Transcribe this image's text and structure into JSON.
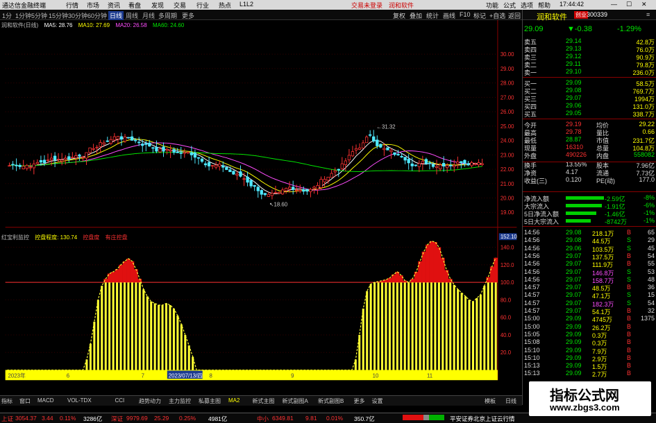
{
  "window": {
    "title": "通达信金融终端",
    "menus": [
      "行情",
      "市场",
      "资讯",
      "看盘",
      "发现",
      "交易",
      "行业",
      "热点",
      "L1L2"
    ],
    "center_links": [
      "交易未登录",
      "润和软件"
    ],
    "right_menus": [
      "功能",
      "公式",
      "选项",
      "帮助"
    ],
    "time": "17:44:42"
  },
  "toolbar": {
    "periods": [
      "1分",
      "1分钟",
      "5分钟",
      "15分钟",
      "30分钟",
      "60分钟",
      "日线",
      "周线",
      "月线",
      "多周期",
      "更多"
    ],
    "right_buttons": [
      "复权",
      "叠加",
      "统计",
      "画线",
      "F10",
      "标记",
      "+自选",
      "返回"
    ]
  },
  "chart": {
    "legend": [
      {
        "text": "润和软件(日线)",
        "color": "#bbbbbb"
      },
      {
        "text": "MA5: 28.76",
        "color": "#ffffff"
      },
      {
        "text": "MA10: 27.69",
        "color": "#ffff00"
      },
      {
        "text": "MA20: 26.58",
        "color": "#ff4dff"
      },
      {
        "text": "MA60: 24.60",
        "color": "#00e600"
      }
    ],
    "price_labels": [
      "30.00",
      "29.00",
      "28.00",
      "27.00",
      "26.00",
      "25.00",
      "24.00",
      "23.00",
      "22.00",
      "21.00",
      "20.00",
      "19.00"
    ],
    "high_mark": "31.32",
    "low_mark": "18.60"
  },
  "indicator": {
    "legend": [
      {
        "text": "红宝利监控",
        "color": "#bbbbbb"
      },
      {
        "text": "控盘程度: 130.74",
        "color": "#ffff00"
      },
      {
        "text": "控盘度",
        "color": "#ff3232"
      },
      {
        "text": "有庄控盘",
        "color": "#ff3232"
      }
    ],
    "axis_labels": [
      "152.10",
      "140.0",
      "120.0",
      "100.0",
      "80.0",
      "60.0",
      "40.0",
      "20.0"
    ],
    "series": [
      0,
      0,
      0,
      0,
      0,
      0,
      0,
      0,
      0,
      0,
      0,
      0,
      0,
      0,
      0,
      0,
      0,
      0,
      0,
      0,
      0,
      12,
      30,
      55,
      80,
      96,
      104,
      110,
      112,
      115,
      120,
      124,
      127,
      124,
      115,
      104,
      92,
      84,
      78,
      76,
      74,
      74,
      76,
      74,
      70,
      62,
      52,
      40,
      28,
      15,
      0,
      0,
      0,
      0,
      0,
      0,
      0,
      0,
      0,
      0,
      0,
      0,
      0,
      0,
      0,
      0,
      0,
      0,
      0,
      0,
      0,
      0,
      0,
      0,
      0,
      0,
      0,
      0,
      0,
      0,
      0,
      0,
      0,
      0,
      0,
      0,
      0,
      0,
      0,
      0,
      0,
      0,
      12,
      40,
      70,
      90,
      98,
      100,
      101,
      102,
      103,
      105,
      109,
      112,
      108,
      102,
      100,
      104,
      112,
      124,
      135,
      143,
      147,
      146,
      140,
      128,
      114,
      104,
      97,
      92,
      88,
      84,
      80,
      78,
      82,
      86,
      96,
      106,
      118,
      128
    ]
  },
  "date_axis": [
    "2023年",
    "6",
    "7",
    "2023/07/13/四",
    "8",
    "9",
    "10",
    "11"
  ],
  "tabs": [
    "指标",
    "窗口",
    "MACD",
    "VOL-TDX",
    "CCI",
    "趋势动力",
    "主力监控",
    "私募主图",
    "MA2",
    "新式主图",
    "新式副图A",
    "新式副图B",
    "更多",
    "设置"
  ],
  "rtabs": [
    "模板",
    "日线"
  ],
  "right_panel": {
    "name": "润和软件",
    "tag": "创业",
    "code": "300339",
    "price": "29.09",
    "change": "▼-0.38",
    "pct": "-1.29%",
    "asks": [
      [
        "卖五",
        "29.14",
        "42.8万"
      ],
      [
        "卖四",
        "29.13",
        "76.0万"
      ],
      [
        "卖三",
        "29.12",
        "90.9万"
      ],
      [
        "卖二",
        "29.11",
        "79.8万"
      ],
      [
        "卖一",
        "29.10",
        "236.0万"
      ]
    ],
    "bids": [
      [
        "买一",
        "29.09",
        "58.5万"
      ],
      [
        "买二",
        "29.08",
        "769.7万"
      ],
      [
        "买三",
        "29.07",
        "1994万"
      ],
      [
        "买四",
        "29.06",
        "131.0万"
      ],
      [
        "买五",
        "29.05",
        "338.7万"
      ]
    ],
    "stats": [
      [
        "今开",
        "29.19",
        "均价",
        "29.22"
      ],
      [
        "最高",
        "29.78",
        "量比",
        "0.66"
      ],
      [
        "最低",
        "28.87",
        "市值",
        "231.7亿"
      ],
      [
        "现量",
        "16310",
        "总量",
        "104.8万"
      ],
      [
        "外盘",
        "490226",
        "内盘",
        "558082"
      ],
      [
        "换手",
        "13.55%",
        "股本",
        "7.96亿"
      ],
      [
        "净资",
        "4.17",
        "流通",
        "7.73亿"
      ],
      [
        "收益(三)",
        "0.120",
        "PE(动)",
        "177.0"
      ]
    ],
    "flows": [
      [
        "净流入额",
        "-2.59亿",
        "-8%"
      ],
      [
        "大宗流入",
        "-1.91亿",
        "-6%"
      ],
      [
        "5日净流入额",
        "-1.46亿",
        "-1%"
      ],
      [
        "5日大宗流入",
        "-8742万",
        "-1%"
      ]
    ],
    "ticks": [
      [
        "14:56",
        "29.08",
        "218.1万",
        "B",
        "65"
      ],
      [
        "14:56",
        "29.08",
        "44.5万",
        "S",
        "29"
      ],
      [
        "14:56",
        "29.06",
        "103.5万",
        "S",
        "45"
      ],
      [
        "14:56",
        "29.07",
        "137.5万",
        "B",
        "54"
      ],
      [
        "14:56",
        "29.07",
        "111.9万",
        "B",
        "55"
      ],
      [
        "14:56",
        "29.07",
        "146.8万",
        "S",
        "53"
      ],
      [
        "14:56",
        "29.07",
        "158.7万",
        "S",
        "48"
      ],
      [
        "14:57",
        "29.07",
        "48.5万",
        "B",
        "36"
      ],
      [
        "14:57",
        "29.07",
        "47.1万",
        "S",
        "15"
      ],
      [
        "14:57",
        "29.07",
        "182.3万",
        "S",
        "54"
      ],
      [
        "14:57",
        "29.07",
        "54.1万",
        "B",
        "32"
      ],
      [
        "15:00",
        "29.09",
        "4745万",
        "B",
        "1375"
      ],
      [
        "15:00",
        "29.09",
        "26.2万",
        "B",
        ""
      ],
      [
        "15:05",
        "29.09",
        "0.3万",
        "B",
        ""
      ],
      [
        "15:08",
        "29.09",
        "0.3万",
        "B",
        ""
      ],
      [
        "15:10",
        "29.09",
        "7.9万",
        "B",
        ""
      ],
      [
        "15:10",
        "29.09",
        "2.9万",
        "B",
        ""
      ],
      [
        "15:13",
        "29.09",
        "1.5万",
        "B",
        ""
      ],
      [
        "15:13",
        "29.09",
        "2.7万",
        "B",
        ""
      ]
    ]
  },
  "status": {
    "items": [
      {
        "label": "上证",
        "value": "3054.37",
        "chg": "3.44",
        "pct": "0.11%",
        "amt": "3286亿"
      },
      {
        "label": "深证",
        "value": "9979.69",
        "chg": "25.29",
        "pct": "0.25%",
        "amt": "4981亿"
      },
      {
        "label": "中小",
        "value": "6349.81",
        "chg": "9.81",
        "pct": "0.01%",
        "amt": "350.7亿"
      }
    ],
    "right": "平安证券北京上证云行情"
  },
  "watermark": {
    "title": "指标公式网",
    "url": "www.zbgs3.com"
  },
  "colors": {
    "up": "#ff3232",
    "down": "#4fe8ff",
    "ma5": "#ffffff",
    "ma10": "#ffff00",
    "ma20": "#ff4dff",
    "ma60": "#00e600",
    "bar_yellow": "#ffff33",
    "bar_red": "#e01010"
  }
}
